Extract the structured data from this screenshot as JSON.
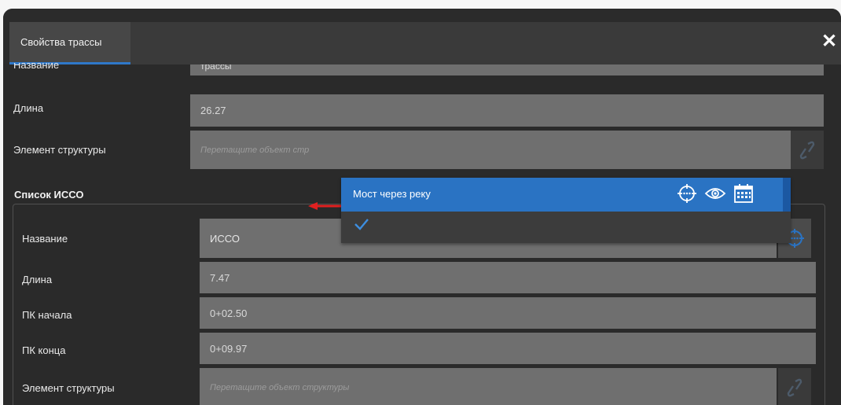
{
  "dialog": {
    "tab_label": "Свойства трассы",
    "close_glyph": "✕"
  },
  "route": {
    "name_label": "Название",
    "name_value": "трассы",
    "length_label": "Длина",
    "length_value": "26.27",
    "structure_label": "Элемент структуры",
    "structure_placeholder": "Перетащите объект стр"
  },
  "dropdown": {
    "item_label": "Мост через реку",
    "icons": [
      "crosshair-icon",
      "eye-icon",
      "calendar-icon"
    ]
  },
  "isso": {
    "section_title": "Список ИССО",
    "name_label": "Название",
    "name_value": "ИССО",
    "length_label": "Длина",
    "length_value": "7.47",
    "pk_start_label": "ПК начала",
    "pk_start_value": "0+02.50",
    "pk_end_label": "ПК конца",
    "pk_end_value": "0+09.97",
    "structure_label": "Элемент структуры",
    "structure_placeholder": "Перетащите объект структуры"
  },
  "colors": {
    "accent": "#2a73c3",
    "annotation_arrow": "#e02020"
  }
}
